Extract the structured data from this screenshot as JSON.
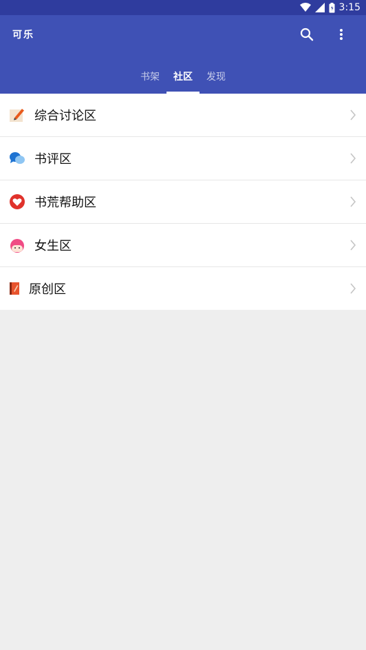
{
  "status": {
    "time": "3:15"
  },
  "app": {
    "title": "可乐"
  },
  "tabs": [
    {
      "label": "书架",
      "active": false
    },
    {
      "label": "社区",
      "active": true
    },
    {
      "label": "发现",
      "active": false
    }
  ],
  "list": {
    "items": [
      {
        "label": "综合讨论区",
        "icon": "notepad-pencil-icon"
      },
      {
        "label": "书评区",
        "icon": "chat-bubbles-icon"
      },
      {
        "label": "书荒帮助区",
        "icon": "heart-icon"
      },
      {
        "label": "女生区",
        "icon": "girl-face-icon"
      },
      {
        "label": "原创区",
        "icon": "book-icon"
      }
    ]
  },
  "colors": {
    "primary": "#3f51b5",
    "status": "#2f3c9e",
    "background": "#eeeeee"
  }
}
